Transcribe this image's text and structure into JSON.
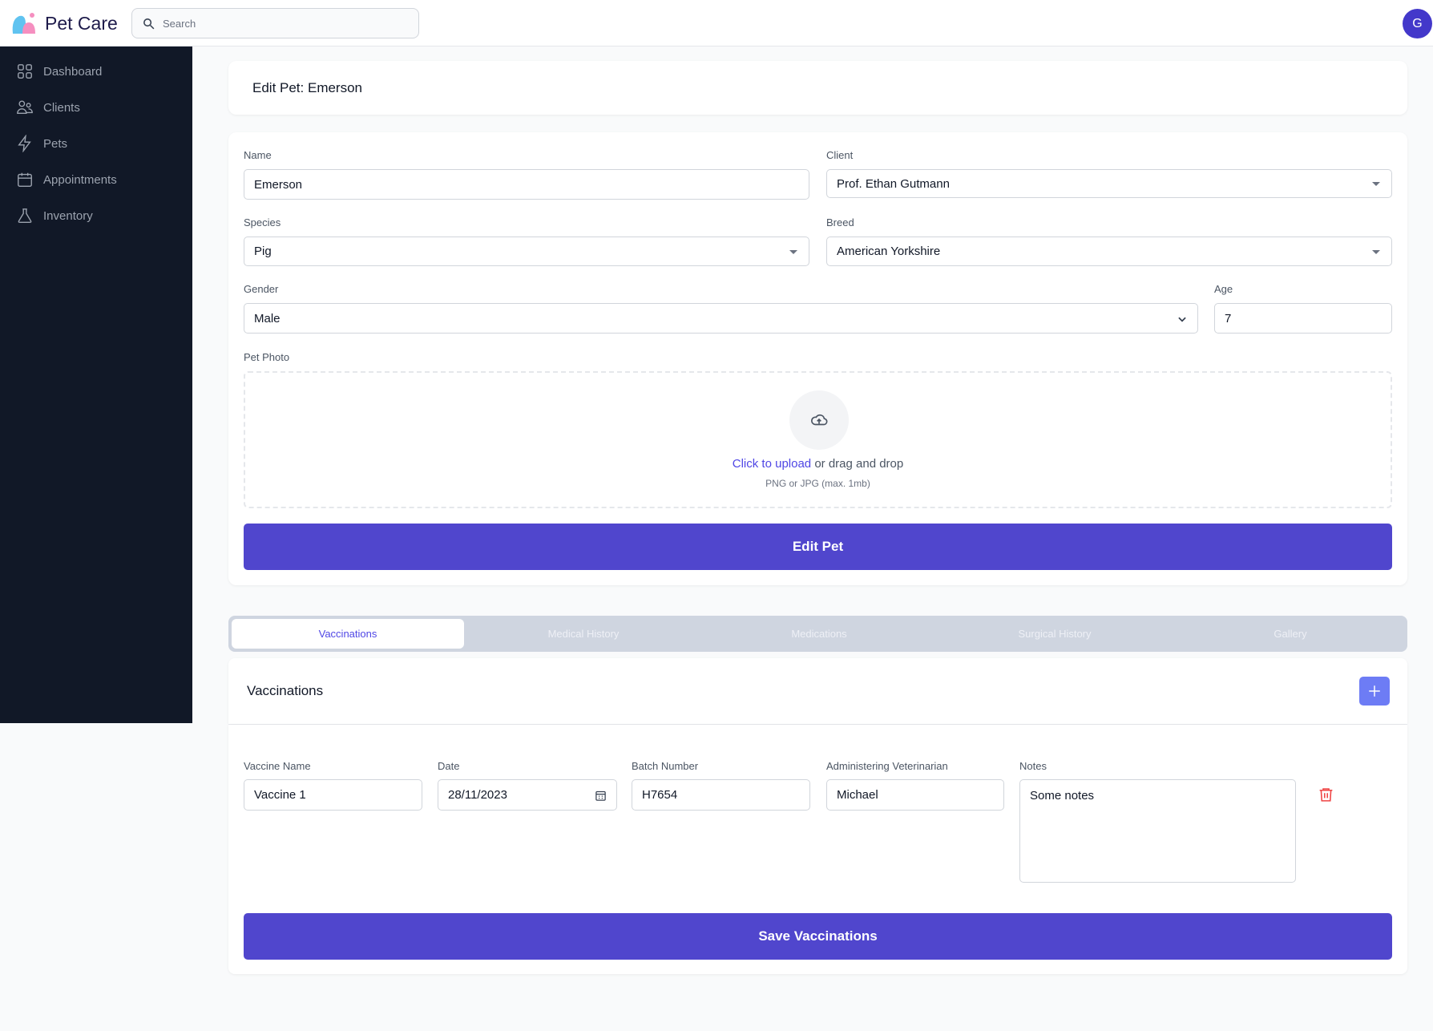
{
  "header": {
    "brand": "Pet Care",
    "search_placeholder": "Search",
    "avatar_initial": "G"
  },
  "sidebar": {
    "items": [
      {
        "label": "Dashboard",
        "icon": "grid-icon"
      },
      {
        "label": "Clients",
        "icon": "users-icon"
      },
      {
        "label": "Pets",
        "icon": "bolt-icon"
      },
      {
        "label": "Appointments",
        "icon": "calendar-icon"
      },
      {
        "label": "Inventory",
        "icon": "flask-icon"
      }
    ]
  },
  "page": {
    "title": "Edit Pet: Emerson"
  },
  "form": {
    "name": {
      "label": "Name",
      "value": "Emerson"
    },
    "client": {
      "label": "Client",
      "value": "Prof. Ethan Gutmann"
    },
    "species": {
      "label": "Species",
      "value": "Pig"
    },
    "breed": {
      "label": "Breed",
      "value": "American Yorkshire"
    },
    "gender": {
      "label": "Gender",
      "value": "Male"
    },
    "age": {
      "label": "Age",
      "value": "7"
    },
    "photo": {
      "label": "Pet Photo",
      "upload_link": "Click to upload",
      "upload_rest": " or drag and drop",
      "hint": "PNG or JPG (max. 1mb)"
    },
    "submit": "Edit Pet"
  },
  "tabs": [
    {
      "label": "Vaccinations",
      "active": true
    },
    {
      "label": "Medical History"
    },
    {
      "label": "Medications"
    },
    {
      "label": "Surgical History"
    },
    {
      "label": "Gallery"
    }
  ],
  "vaccinations": {
    "title": "Vaccinations",
    "columns": [
      "Vaccine Name",
      "Date",
      "Batch Number",
      "Administering Veterinarian",
      "Notes"
    ],
    "rows": [
      {
        "vaccine": "Vaccine 1",
        "date": "28/11/2023",
        "batch": "H7654",
        "vet": "Michael",
        "notes": "Some notes"
      }
    ],
    "save": "Save Vaccinations"
  },
  "colors": {
    "primary": "#5046cd",
    "sidebar": "#111827",
    "add_button": "#6d7cf5",
    "delete": "#ef4444"
  }
}
